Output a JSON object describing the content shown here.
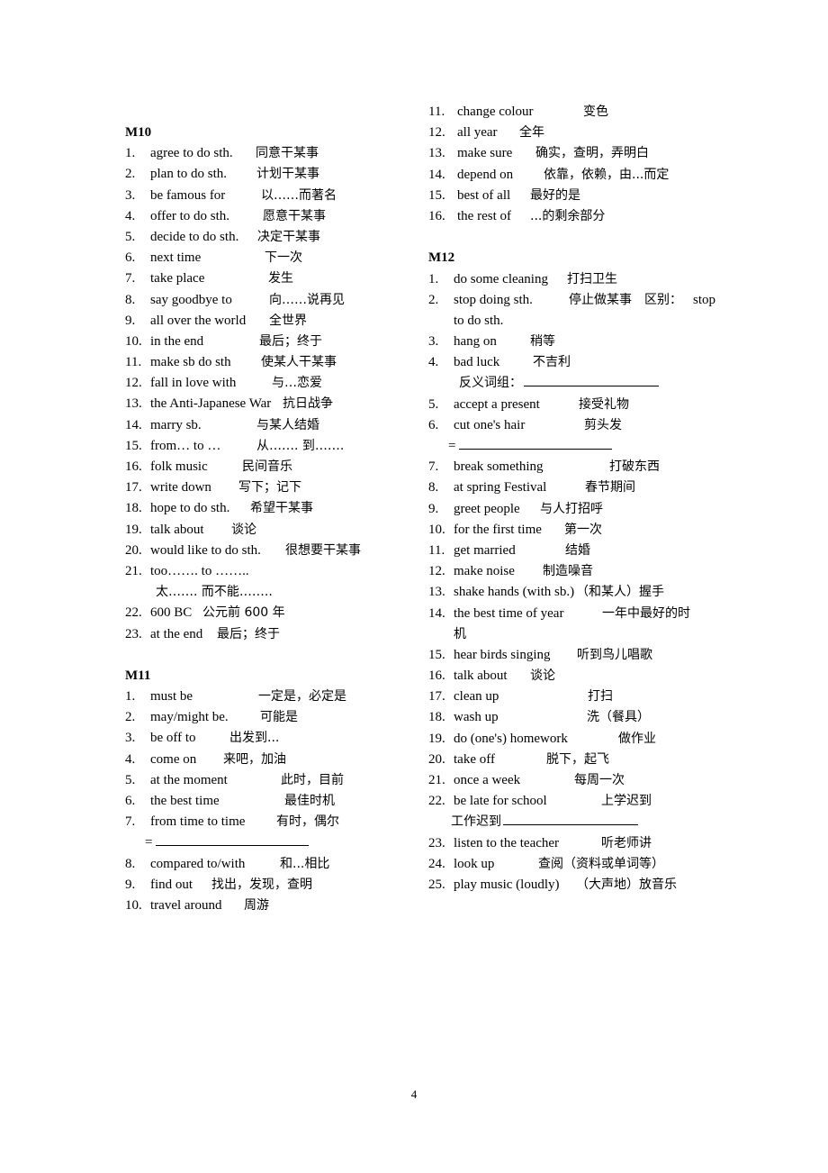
{
  "page_number": "4",
  "left_column": {
    "sections": [
      {
        "heading": "M10",
        "items": [
          {
            "num": "1.",
            "en": "agree to do sth.",
            "zh": "同意干某事"
          },
          {
            "num": "2.",
            "en": "plan to do sth.",
            "zh": "计划干某事"
          },
          {
            "num": "3.",
            "en": "be famous for",
            "zh": "以……而著名"
          },
          {
            "num": "4.",
            "en": "offer to do sth.",
            "zh": "愿意干某事"
          },
          {
            "num": "5.",
            "en": "decide to do sth.",
            "zh": "决定干某事"
          },
          {
            "num": "6.",
            "en": "next time",
            "zh": "下一次"
          },
          {
            "num": "7.",
            "en": "take place",
            "zh": "发生"
          },
          {
            "num": "8.",
            "en": "say goodbye to",
            "zh": "向……说再见"
          },
          {
            "num": "9.",
            "en": "all over the world",
            "zh": "全世界"
          },
          {
            "num": "10.",
            "en": "in the end",
            "zh": "最后；终于"
          },
          {
            "num": "11.",
            "en": "make sb do sth",
            "zh": "使某人干某事"
          },
          {
            "num": "12.",
            "en": "fall in love with",
            "zh": "与…恋爱"
          },
          {
            "num": "13.",
            "en": "the Anti-Japanese War",
            "zh": "抗日战争"
          },
          {
            "num": "14.",
            "en": "marry sb.",
            "zh": "与某人结婚"
          },
          {
            "num": "15.",
            "en": "from… to …",
            "zh": "从……. 到……."
          },
          {
            "num": "16.",
            "en": "folk music",
            "zh": "民间音乐"
          },
          {
            "num": "17.",
            "en": "write down",
            "zh": "写下；记下"
          },
          {
            "num": "18.",
            "en": "hope to do sth.",
            "zh": "希望干某事"
          },
          {
            "num": "19.",
            "en": "talk about",
            "zh": "谈论"
          },
          {
            "num": "20.",
            "en": "would like to do sth.",
            "zh": "很想要干某事"
          },
          {
            "num": "21.",
            "en": "too……. to ……..",
            "zh": "",
            "continuation": "太……. 而不能…….."
          },
          {
            "num": "22.",
            "en": "600 BC",
            "zh": "公元前 600 年"
          },
          {
            "num": "23.",
            "en": "at the end",
            "zh": "最后；终于"
          }
        ]
      },
      {
        "heading": "M11",
        "items": [
          {
            "num": "1.",
            "en": "must be",
            "zh": "一定是，必定是"
          },
          {
            "num": "2.",
            "en": "may/might be.",
            "zh": "可能是"
          },
          {
            "num": "3.",
            "en": "be off to",
            "zh": "出发到..."
          },
          {
            "num": "4.",
            "en": "come on",
            "zh": "来吧，加油"
          },
          {
            "num": "5.",
            "en": "at the moment",
            "zh": "此时，目前"
          },
          {
            "num": "6.",
            "en": "the best time",
            "zh": "最佳时机"
          },
          {
            "num": "7.",
            "en": "from time to time",
            "zh": "有时，偶尔",
            "blank_prefix": "="
          },
          {
            "num": "8.",
            "en": "compared to/with",
            "zh": "和...相比"
          },
          {
            "num": "9.",
            "en": "find out",
            "zh": "找出，发现，查明"
          },
          {
            "num": "10.",
            "en": "travel around",
            "zh": "周游"
          }
        ]
      }
    ]
  },
  "right_column": {
    "continued_items": [
      {
        "num": "11.",
        "en": "change colour",
        "zh": "变色"
      },
      {
        "num": "12.",
        "en": "all year",
        "zh": "全年"
      },
      {
        "num": "13.",
        "en": "make sure",
        "zh": "确实，查明，弄明白"
      },
      {
        "num": "14.",
        "en": "depend on",
        "zh": "依靠，依赖，由...而定"
      },
      {
        "num": "15.",
        "en": "best of all",
        "zh": "最好的是"
      },
      {
        "num": "16.",
        "en": "the rest of",
        "zh": "...的剩余部分"
      }
    ],
    "sections": [
      {
        "heading": "M12",
        "items": [
          {
            "num": "1.",
            "en": "do some cleaning",
            "zh": "打扫卫生"
          },
          {
            "num": "2.",
            "en": "stop doing sth.",
            "zh": "停止做某事　区别：",
            "tail": "stop",
            "continuation": "to do sth."
          },
          {
            "num": "3.",
            "en": "hang on",
            "zh": "稍等"
          },
          {
            "num": "4.",
            "en": "bad luck",
            "zh": "不吉利",
            "blank_label": "反义词组："
          },
          {
            "num": "5.",
            "en": "accept a present",
            "zh": "接受礼物"
          },
          {
            "num": "6.",
            "en": "cut one's hair",
            "zh": "剪头发",
            "blank_prefix": "="
          },
          {
            "num": "7.",
            "en": "break something",
            "zh": "打破东西"
          },
          {
            "num": "8.",
            "en": "at spring Festival",
            "zh": "春节期间"
          },
          {
            "num": "9.",
            "en": "greet people",
            "zh": "与人打招呼"
          },
          {
            "num": "10.",
            "en": "for the first time",
            "zh": "第一次"
          },
          {
            "num": "11.",
            "en": "get married",
            "zh": "结婚"
          },
          {
            "num": "12.",
            "en": "make noise",
            "zh": "制造噪音"
          },
          {
            "num": "13.",
            "en": "shake hands (with sb.)",
            "zh": "（和某人）握手"
          },
          {
            "num": "14.",
            "en": "the best time of year",
            "zh": "一年中最好的时",
            "continuation": "机"
          },
          {
            "num": "15.",
            "en": "hear birds singing",
            "zh": "听到鸟儿唱歌"
          },
          {
            "num": "16.",
            "en": "talk about",
            "zh": "谈论"
          },
          {
            "num": "17.",
            "en": "clean up",
            "zh": "打扫"
          },
          {
            "num": "18.",
            "en": "wash up",
            "zh": "洗（餐具）"
          },
          {
            "num": "19.",
            "en": "do (one's) homework",
            "zh": "做作业"
          },
          {
            "num": "20.",
            "en": "take off",
            "zh": "脱下，起飞"
          },
          {
            "num": "21.",
            "en": "once a week",
            "zh": "每周一次"
          },
          {
            "num": "22.",
            "en": "be late for school",
            "zh": "上学迟到",
            "blank_label": "工作迟到"
          },
          {
            "num": "23.",
            "en": "listen to the teacher",
            "zh": "听老师讲"
          },
          {
            "num": "24.",
            "en": "look up",
            "zh": "查阅（资料或单词等）"
          },
          {
            "num": "25.",
            "en": "play music (loudly)",
            "zh": "（大声地）放音乐"
          }
        ]
      }
    ]
  }
}
